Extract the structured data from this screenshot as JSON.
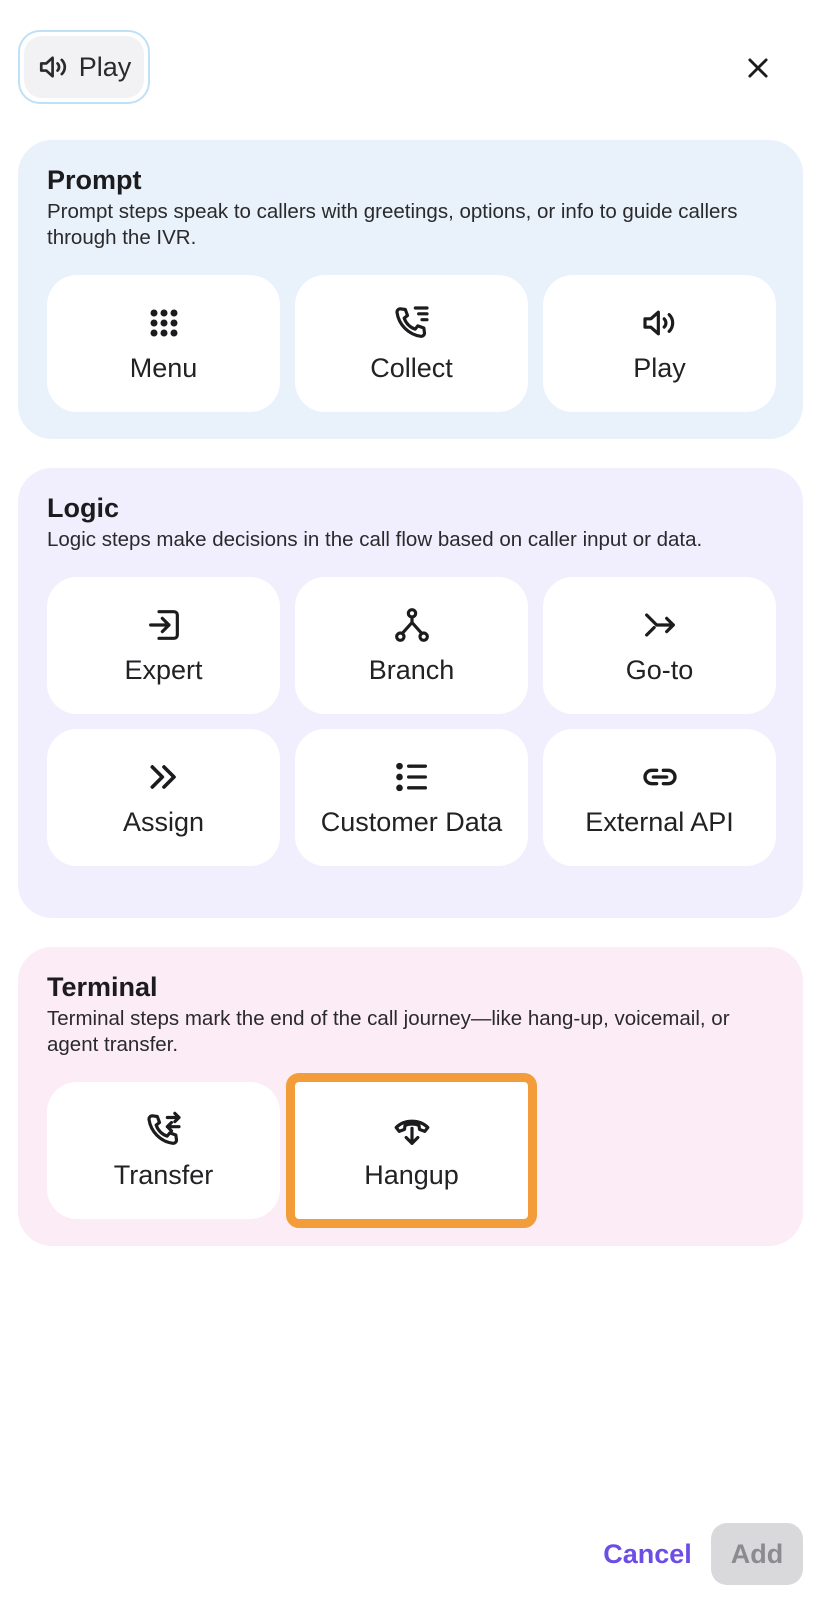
{
  "header": {
    "chip_label": "Play",
    "chip_icon": "speaker-icon",
    "close_icon": "close-icon"
  },
  "sections": {
    "prompt": {
      "title": "Prompt",
      "description": "Prompt steps speak to callers with greetings, options, or info to guide callers through the IVR.",
      "background": "#e9f1fa",
      "items": [
        {
          "label": "Menu",
          "icon": "keypad-icon"
        },
        {
          "label": "Collect",
          "icon": "phone-list-icon"
        },
        {
          "label": "Play",
          "icon": "speaker-icon"
        }
      ]
    },
    "logic": {
      "title": "Logic",
      "description": "Logic steps make decisions in the call flow based on caller input or data.",
      "background": "#f1effd",
      "items": [
        {
          "label": "Expert",
          "icon": "enter-box-icon"
        },
        {
          "label": "Branch",
          "icon": "branch-icon"
        },
        {
          "label": "Go-to",
          "icon": "go-to-arrow-icon"
        },
        {
          "label": "Assign",
          "icon": "double-chevron-right-icon"
        },
        {
          "label": "Customer Data",
          "icon": "list-icon"
        },
        {
          "label": "External API",
          "icon": "link-icon"
        }
      ]
    },
    "terminal": {
      "title": "Terminal",
      "description": "Terminal steps mark the end of the call journey—like hang-up, voicemail, or agent transfer.",
      "background": "#fbecf5",
      "items": [
        {
          "label": "Transfer",
          "icon": "phone-transfer-icon"
        },
        {
          "label": "Hangup",
          "icon": "hangup-icon",
          "highlighted": true
        }
      ]
    }
  },
  "footer": {
    "cancel_label": "Cancel",
    "add_label": "Add",
    "add_disabled": true
  },
  "colors": {
    "accent": "#6c4ee6",
    "highlight": "#f29d3a"
  }
}
